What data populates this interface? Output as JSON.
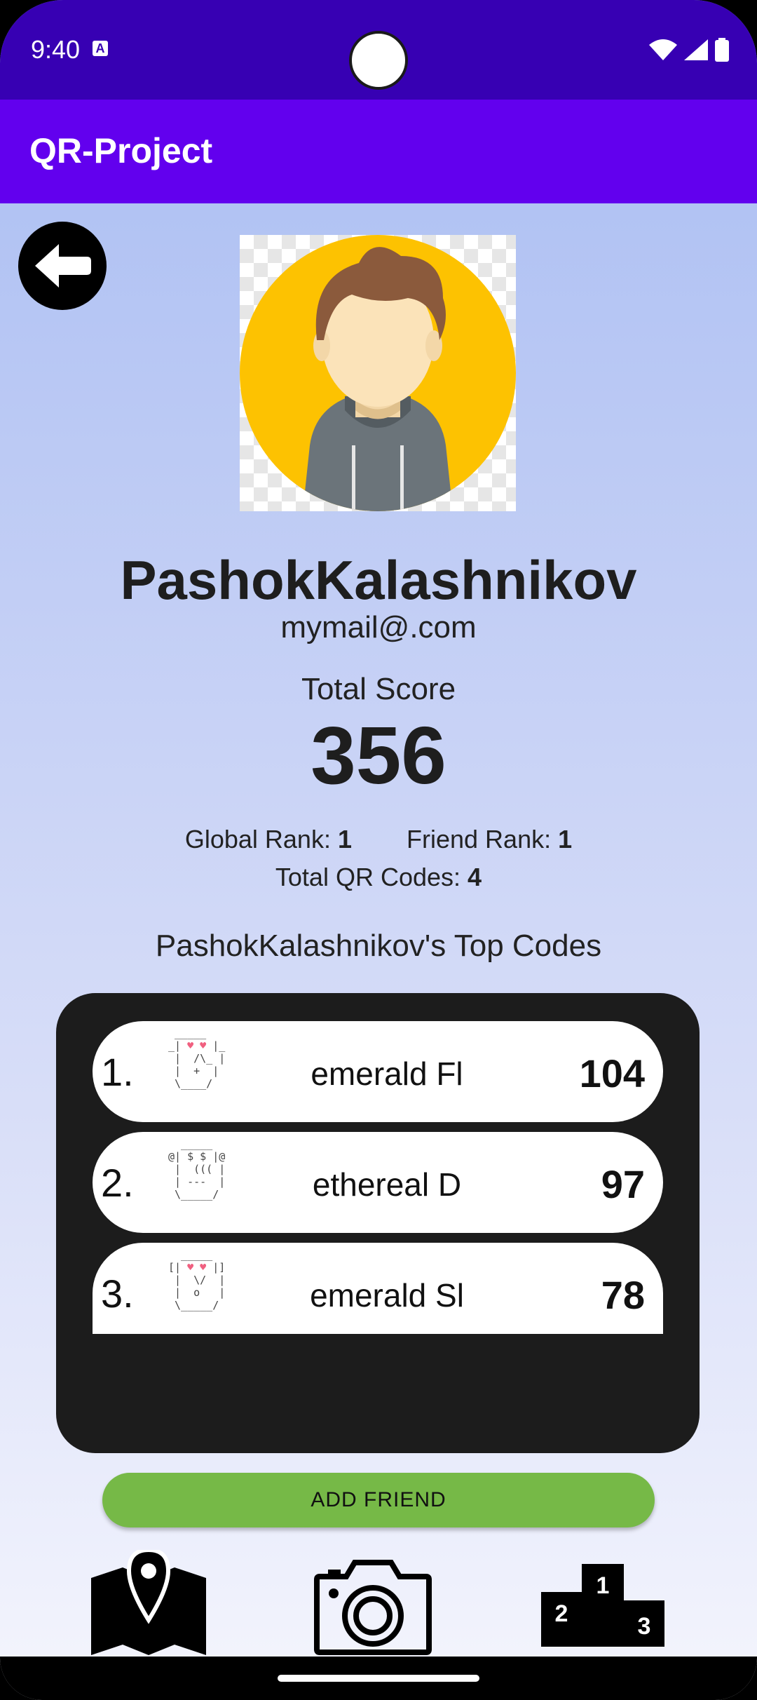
{
  "status_bar": {
    "time": "9:40",
    "notification_icon": "A"
  },
  "app_bar": {
    "title": "QR-Project"
  },
  "profile": {
    "username": "PashokKalashnikov",
    "email": "mymail@.com",
    "total_score_label": "Total Score",
    "total_score": "356",
    "global_rank_label": "Global Rank:",
    "global_rank": "1",
    "friend_rank_label": "Friend Rank:",
    "friend_rank": "1",
    "total_qr_label": "Total QR Codes:",
    "total_qr": "4",
    "top_codes_title": "PashokKalashnikov's Top Codes"
  },
  "top_codes": [
    {
      "rank": "1.",
      "name": "emerald Fl",
      "score": "104"
    },
    {
      "rank": "2.",
      "name": "ethereal D",
      "score": "97"
    },
    {
      "rank": "3.",
      "name": "emerald Sl",
      "score": "78"
    }
  ],
  "actions": {
    "add_friend": "ADD FRIEND"
  },
  "nav": {
    "items": [
      "map-icon",
      "camera-icon",
      "leaderboard-icon"
    ],
    "podium_labels": [
      "1",
      "2",
      "3"
    ]
  },
  "colors": {
    "status_bar": "#3700b3",
    "app_bar": "#6200ee",
    "add_friend": "#76b947",
    "panel": "#1c1c1c"
  }
}
